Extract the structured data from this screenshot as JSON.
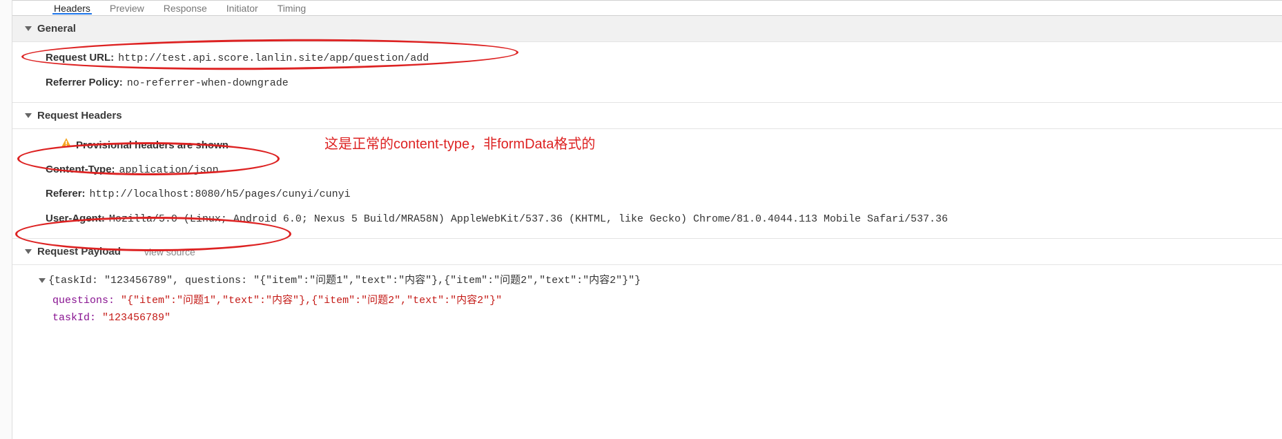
{
  "tabs": {
    "t0": "Headers",
    "t1": "Preview",
    "t2": "Response",
    "t3": "Initiator",
    "t4": "Timing"
  },
  "general": {
    "title": "General",
    "request_url_label": "Request URL:",
    "request_url_value": "http://test.api.score.lanlin.site/app/question/add",
    "referrer_policy_label": "Referrer Policy:",
    "referrer_policy_value": "no-referrer-when-downgrade"
  },
  "request_headers": {
    "title": "Request Headers",
    "provisional": "Provisional headers are shown",
    "content_type_label": "Content-Type:",
    "content_type_value": "application/json",
    "referer_label": "Referer:",
    "referer_value": "http://localhost:8080/h5/pages/cunyi/cunyi",
    "user_agent_label": "User-Agent:",
    "user_agent_value": "Mozilla/5.0 (Linux; Android 6.0; Nexus 5 Build/MRA58N) AppleWebKit/537.36 (KHTML, like Gecko) Chrome/81.0.4044.113 Mobile Safari/537.36"
  },
  "payload": {
    "title": "Request Payload",
    "view_source": "view source",
    "summary_prefix": "{taskId: ",
    "summary_taskid": "\"123456789\"",
    "summary_mid": ", questions: ",
    "summary_questions": "\"{\"item\":\"问题1\",\"text\":\"内容\"},{\"item\":\"问题2\",\"text\":\"内容2\"}\"",
    "summary_suffix": "}",
    "questions_key": "questions:",
    "questions_val": "\"{\"item\":\"问题1\",\"text\":\"内容\"},{\"item\":\"问题2\",\"text\":\"内容2\"}\"",
    "taskid_key": "taskId:",
    "taskid_val": "\"123456789\""
  },
  "annotation": "这是正常的content-type，非formData格式的"
}
